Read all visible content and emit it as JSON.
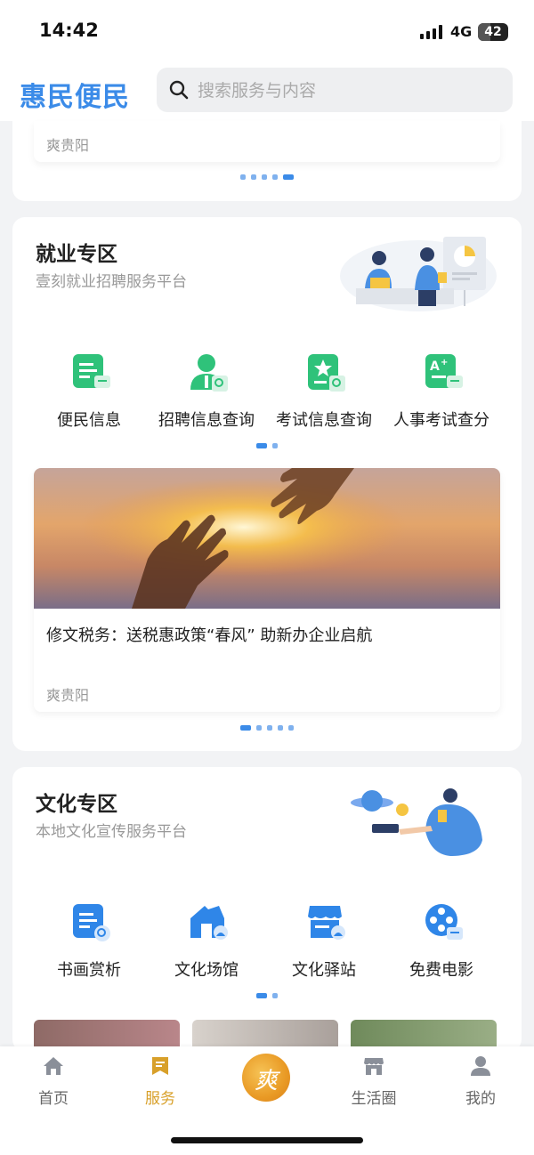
{
  "status_bar": {
    "time": "14:42",
    "network": "4G",
    "battery": "42"
  },
  "header": {
    "logo": "惠民便民",
    "search_placeholder": "搜索服务与内容"
  },
  "top_card": {
    "source": "爽贵阳"
  },
  "employment": {
    "title": "就业专区",
    "subtitle": "壹刻就业招聘服务平台",
    "items": [
      {
        "label": "便民信息",
        "icon": "document-chat-icon"
      },
      {
        "label": "招聘信息查询",
        "icon": "person-search-icon"
      },
      {
        "label": "考试信息查询",
        "icon": "star-document-search-icon"
      },
      {
        "label": "人事考试查分",
        "icon": "grade-a-plus-icon"
      }
    ],
    "news": {
      "title": "修文税务：送税惠政策“春风” 助新办企业启航",
      "source": "爽贵阳"
    }
  },
  "culture": {
    "title": "文化专区",
    "subtitle": "本地文化宣传服务平台",
    "items": [
      {
        "label": "书画赏析",
        "icon": "document-search-icon"
      },
      {
        "label": "文化场馆",
        "icon": "venue-icon"
      },
      {
        "label": "文化驿站",
        "icon": "store-icon"
      },
      {
        "label": "免费电影",
        "icon": "film-reel-icon"
      }
    ]
  },
  "tab_bar": {
    "tabs": [
      {
        "label": "首页",
        "icon": "home-icon",
        "active": false
      },
      {
        "label": "服务",
        "icon": "service-icon",
        "active": true
      },
      {
        "label": "",
        "icon": "shuang-logo-icon",
        "center_char": "爽"
      },
      {
        "label": "生活圈",
        "icon": "shop-icon",
        "active": false
      },
      {
        "label": "我的",
        "icon": "user-icon",
        "active": false
      }
    ]
  },
  "colors": {
    "accent": "#3b8be8",
    "icon_green": "#2fc27a",
    "tab_active": "#d8a02a"
  }
}
